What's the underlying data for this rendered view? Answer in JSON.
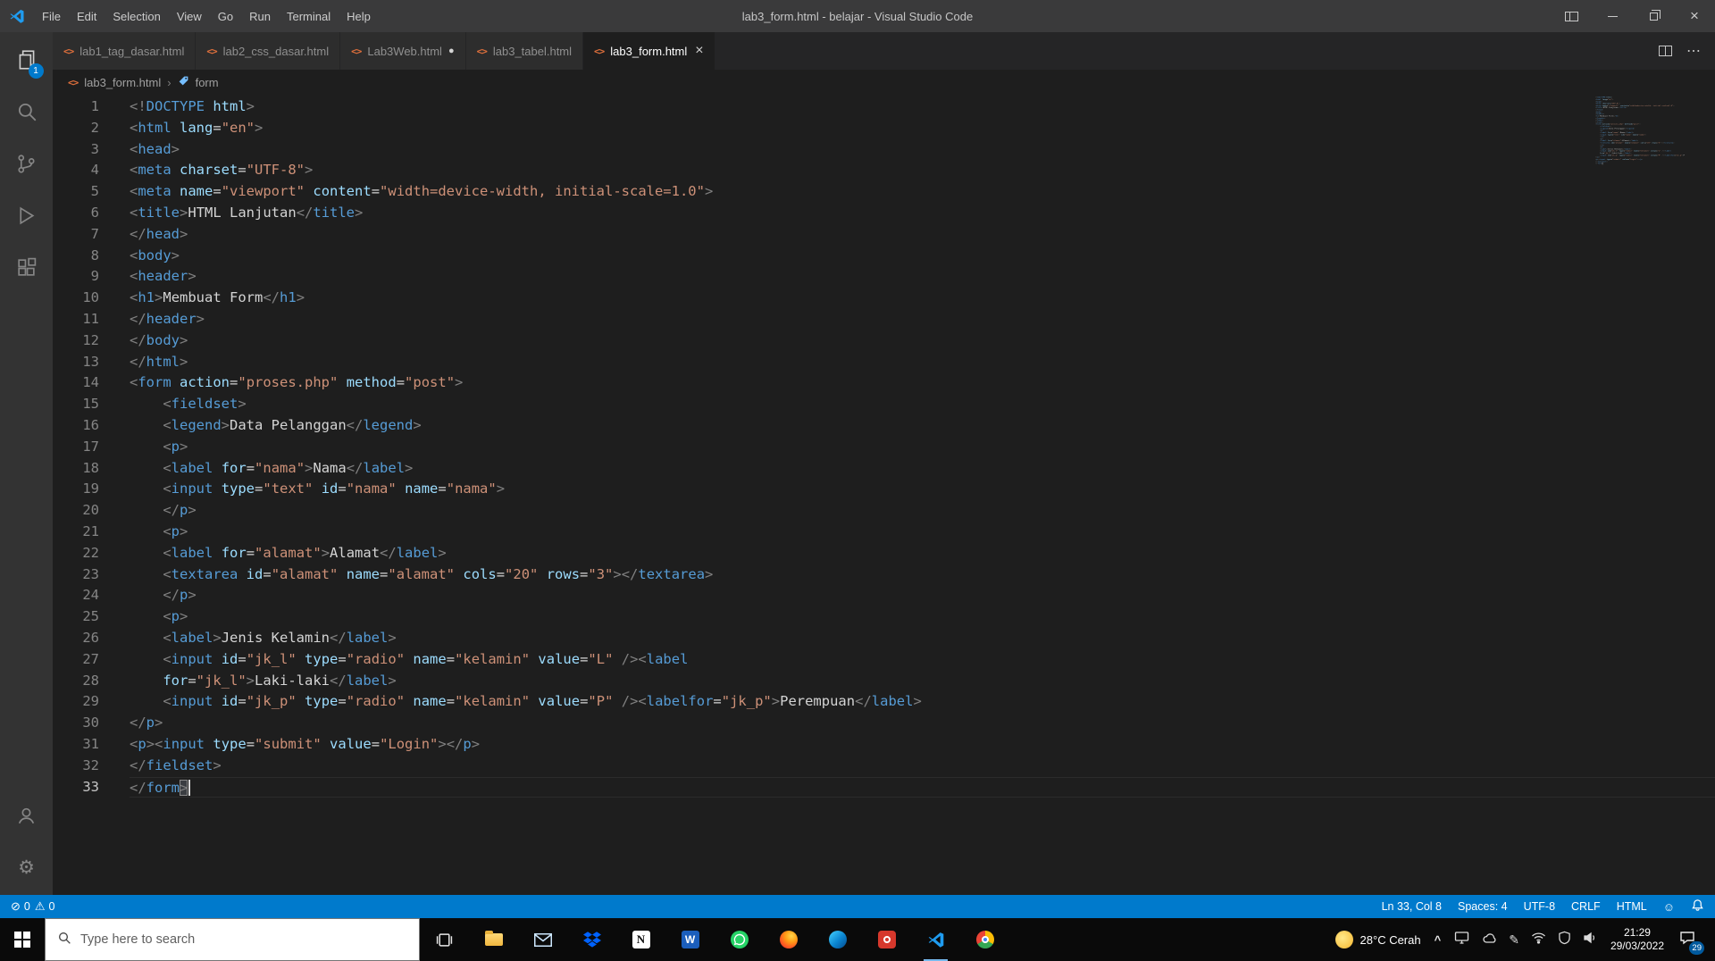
{
  "window": {
    "title": "lab3_form.html - belajar - Visual Studio Code"
  },
  "menu_bar": {
    "items": [
      "File",
      "Edit",
      "Selection",
      "View",
      "Go",
      "Run",
      "Terminal",
      "Help"
    ]
  },
  "tabs": [
    {
      "label": "lab1_tag_dasar.html",
      "modified": false,
      "active": false
    },
    {
      "label": "lab2_css_dasar.html",
      "modified": false,
      "active": false
    },
    {
      "label": "Lab3Web.html",
      "modified": true,
      "active": false
    },
    {
      "label": "lab3_tabel.html",
      "modified": false,
      "active": false
    },
    {
      "label": "lab3_form.html",
      "modified": false,
      "active": true
    }
  ],
  "breadcrumb": {
    "file": "lab3_form.html",
    "symbol": "form"
  },
  "activity_bar": {
    "explorer_badge": "1"
  },
  "editor": {
    "lines": [
      [
        [
          "p",
          "<!"
        ],
        [
          "t",
          "DOCTYPE"
        ],
        [
          "x",
          " "
        ],
        [
          "a",
          "html"
        ],
        [
          "p",
          ">"
        ]
      ],
      [
        [
          "p",
          "<"
        ],
        [
          "t",
          "html"
        ],
        [
          "x",
          " "
        ],
        [
          "a",
          "lang"
        ],
        [
          "x",
          "="
        ],
        [
          "v",
          "\"en\""
        ],
        [
          "p",
          ">"
        ]
      ],
      [
        [
          "p",
          "<"
        ],
        [
          "t",
          "head"
        ],
        [
          "p",
          ">"
        ]
      ],
      [
        [
          "p",
          "<"
        ],
        [
          "t",
          "meta"
        ],
        [
          "x",
          " "
        ],
        [
          "a",
          "charset"
        ],
        [
          "x",
          "="
        ],
        [
          "v",
          "\"UTF-8\""
        ],
        [
          "p",
          ">"
        ]
      ],
      [
        [
          "p",
          "<"
        ],
        [
          "t",
          "meta"
        ],
        [
          "x",
          " "
        ],
        [
          "a",
          "name"
        ],
        [
          "x",
          "="
        ],
        [
          "v",
          "\"viewport\""
        ],
        [
          "x",
          " "
        ],
        [
          "a",
          "content"
        ],
        [
          "x",
          "="
        ],
        [
          "v",
          "\"width=device-width, initial-scale=1.0\""
        ],
        [
          "p",
          ">"
        ]
      ],
      [
        [
          "p",
          "<"
        ],
        [
          "t",
          "title"
        ],
        [
          "p",
          ">"
        ],
        [
          "x",
          "HTML Lanjutan"
        ],
        [
          "p",
          "</"
        ],
        [
          "t",
          "title"
        ],
        [
          "p",
          ">"
        ]
      ],
      [
        [
          "p",
          "</"
        ],
        [
          "t",
          "head"
        ],
        [
          "p",
          ">"
        ]
      ],
      [
        [
          "p",
          "<"
        ],
        [
          "t",
          "body"
        ],
        [
          "p",
          ">"
        ]
      ],
      [
        [
          "p",
          "<"
        ],
        [
          "t",
          "header"
        ],
        [
          "p",
          ">"
        ]
      ],
      [
        [
          "p",
          "<"
        ],
        [
          "t",
          "h1"
        ],
        [
          "p",
          ">"
        ],
        [
          "x",
          "Membuat Form"
        ],
        [
          "p",
          "</"
        ],
        [
          "t",
          "h1"
        ],
        [
          "p",
          ">"
        ]
      ],
      [
        [
          "p",
          "</"
        ],
        [
          "t",
          "header"
        ],
        [
          "p",
          ">"
        ]
      ],
      [
        [
          "p",
          "</"
        ],
        [
          "t",
          "body"
        ],
        [
          "p",
          ">"
        ]
      ],
      [
        [
          "p",
          "</"
        ],
        [
          "t",
          "html"
        ],
        [
          "p",
          ">"
        ]
      ],
      [
        [
          "p",
          "<"
        ],
        [
          "t",
          "form"
        ],
        [
          "x",
          " "
        ],
        [
          "a",
          "action"
        ],
        [
          "x",
          "="
        ],
        [
          "v",
          "\"proses.php\""
        ],
        [
          "x",
          " "
        ],
        [
          "a",
          "method"
        ],
        [
          "x",
          "="
        ],
        [
          "v",
          "\"post\""
        ],
        [
          "p",
          ">"
        ]
      ],
      [
        [
          "x",
          "    "
        ],
        [
          "p",
          "<"
        ],
        [
          "t",
          "fieldset"
        ],
        [
          "p",
          ">"
        ]
      ],
      [
        [
          "x",
          "    "
        ],
        [
          "p",
          "<"
        ],
        [
          "t",
          "legend"
        ],
        [
          "p",
          ">"
        ],
        [
          "x",
          "Data Pelanggan"
        ],
        [
          "p",
          "</"
        ],
        [
          "t",
          "legend"
        ],
        [
          "p",
          ">"
        ]
      ],
      [
        [
          "x",
          "    "
        ],
        [
          "p",
          "<"
        ],
        [
          "t",
          "p"
        ],
        [
          "p",
          ">"
        ]
      ],
      [
        [
          "x",
          "    "
        ],
        [
          "p",
          "<"
        ],
        [
          "t",
          "label"
        ],
        [
          "x",
          " "
        ],
        [
          "a",
          "for"
        ],
        [
          "x",
          "="
        ],
        [
          "v",
          "\"nama\""
        ],
        [
          "p",
          ">"
        ],
        [
          "x",
          "Nama"
        ],
        [
          "p",
          "</"
        ],
        [
          "t",
          "label"
        ],
        [
          "p",
          ">"
        ]
      ],
      [
        [
          "x",
          "    "
        ],
        [
          "p",
          "<"
        ],
        [
          "t",
          "input"
        ],
        [
          "x",
          " "
        ],
        [
          "a",
          "type"
        ],
        [
          "x",
          "="
        ],
        [
          "v",
          "\"text\""
        ],
        [
          "x",
          " "
        ],
        [
          "a",
          "id"
        ],
        [
          "x",
          "="
        ],
        [
          "v",
          "\"nama\""
        ],
        [
          "x",
          " "
        ],
        [
          "a",
          "name"
        ],
        [
          "x",
          "="
        ],
        [
          "v",
          "\"nama\""
        ],
        [
          "p",
          ">"
        ]
      ],
      [
        [
          "x",
          "    "
        ],
        [
          "p",
          "</"
        ],
        [
          "t",
          "p"
        ],
        [
          "p",
          ">"
        ]
      ],
      [
        [
          "x",
          "    "
        ],
        [
          "p",
          "<"
        ],
        [
          "t",
          "p"
        ],
        [
          "p",
          ">"
        ]
      ],
      [
        [
          "x",
          "    "
        ],
        [
          "p",
          "<"
        ],
        [
          "t",
          "label"
        ],
        [
          "x",
          " "
        ],
        [
          "a",
          "for"
        ],
        [
          "x",
          "="
        ],
        [
          "v",
          "\"alamat\""
        ],
        [
          "p",
          ">"
        ],
        [
          "x",
          "Alamat"
        ],
        [
          "p",
          "</"
        ],
        [
          "t",
          "label"
        ],
        [
          "p",
          ">"
        ]
      ],
      [
        [
          "x",
          "    "
        ],
        [
          "p",
          "<"
        ],
        [
          "t",
          "textarea"
        ],
        [
          "x",
          " "
        ],
        [
          "a",
          "id"
        ],
        [
          "x",
          "="
        ],
        [
          "v",
          "\"alamat\""
        ],
        [
          "x",
          " "
        ],
        [
          "a",
          "name"
        ],
        [
          "x",
          "="
        ],
        [
          "v",
          "\"alamat\""
        ],
        [
          "x",
          " "
        ],
        [
          "a",
          "cols"
        ],
        [
          "x",
          "="
        ],
        [
          "v",
          "\"20\""
        ],
        [
          "x",
          " "
        ],
        [
          "a",
          "rows"
        ],
        [
          "x",
          "="
        ],
        [
          "v",
          "\"3\""
        ],
        [
          "p",
          "></"
        ],
        [
          "t",
          "textarea"
        ],
        [
          "p",
          ">"
        ]
      ],
      [
        [
          "x",
          "    "
        ],
        [
          "p",
          "</"
        ],
        [
          "t",
          "p"
        ],
        [
          "p",
          ">"
        ]
      ],
      [
        [
          "x",
          "    "
        ],
        [
          "p",
          "<"
        ],
        [
          "t",
          "p"
        ],
        [
          "p",
          ">"
        ]
      ],
      [
        [
          "x",
          "    "
        ],
        [
          "p",
          "<"
        ],
        [
          "t",
          "label"
        ],
        [
          "p",
          ">"
        ],
        [
          "x",
          "Jenis Kelamin"
        ],
        [
          "p",
          "</"
        ],
        [
          "t",
          "label"
        ],
        [
          "p",
          ">"
        ]
      ],
      [
        [
          "x",
          "    "
        ],
        [
          "p",
          "<"
        ],
        [
          "t",
          "input"
        ],
        [
          "x",
          " "
        ],
        [
          "a",
          "id"
        ],
        [
          "x",
          "="
        ],
        [
          "v",
          "\"jk_l\""
        ],
        [
          "x",
          " "
        ],
        [
          "a",
          "type"
        ],
        [
          "x",
          "="
        ],
        [
          "v",
          "\"radio\""
        ],
        [
          "x",
          " "
        ],
        [
          "a",
          "name"
        ],
        [
          "x",
          "="
        ],
        [
          "v",
          "\"kelamin\""
        ],
        [
          "x",
          " "
        ],
        [
          "a",
          "value"
        ],
        [
          "x",
          "="
        ],
        [
          "v",
          "\"L\""
        ],
        [
          "x",
          " "
        ],
        [
          "p",
          "/><"
        ],
        [
          "t",
          "label"
        ]
      ],
      [
        [
          "x",
          "    "
        ],
        [
          "a",
          "for"
        ],
        [
          "x",
          "="
        ],
        [
          "v",
          "\"jk_l\""
        ],
        [
          "p",
          ">"
        ],
        [
          "x",
          "Laki-laki"
        ],
        [
          "p",
          "</"
        ],
        [
          "t",
          "label"
        ],
        [
          "p",
          ">"
        ]
      ],
      [
        [
          "x",
          "    "
        ],
        [
          "p",
          "<"
        ],
        [
          "t",
          "input"
        ],
        [
          "x",
          " "
        ],
        [
          "a",
          "id"
        ],
        [
          "x",
          "="
        ],
        [
          "v",
          "\"jk_p\""
        ],
        [
          "x",
          " "
        ],
        [
          "a",
          "type"
        ],
        [
          "x",
          "="
        ],
        [
          "v",
          "\"radio\""
        ],
        [
          "x",
          " "
        ],
        [
          "a",
          "name"
        ],
        [
          "x",
          "="
        ],
        [
          "v",
          "\"kelamin\""
        ],
        [
          "x",
          " "
        ],
        [
          "a",
          "value"
        ],
        [
          "x",
          "="
        ],
        [
          "v",
          "\"P\""
        ],
        [
          "x",
          " "
        ],
        [
          "p",
          "/><"
        ],
        [
          "t",
          "labelfor"
        ],
        [
          "x",
          "="
        ],
        [
          "v",
          "\"jk_p\""
        ],
        [
          "p",
          ">"
        ],
        [
          "x",
          "Perempuan"
        ],
        [
          "p",
          "</"
        ],
        [
          "t",
          "label"
        ],
        [
          "p",
          ">"
        ]
      ],
      [
        [
          "p",
          "</"
        ],
        [
          "t",
          "p"
        ],
        [
          "p",
          ">"
        ]
      ],
      [
        [
          "p",
          "<"
        ],
        [
          "t",
          "p"
        ],
        [
          "p",
          "><"
        ],
        [
          "t",
          "input"
        ],
        [
          "x",
          " "
        ],
        [
          "a",
          "type"
        ],
        [
          "x",
          "="
        ],
        [
          "v",
          "\"submit\""
        ],
        [
          "x",
          " "
        ],
        [
          "a",
          "value"
        ],
        [
          "x",
          "="
        ],
        [
          "v",
          "\"Login\""
        ],
        [
          "p",
          "></"
        ],
        [
          "t",
          "p"
        ],
        [
          "p",
          ">"
        ]
      ],
      [
        [
          "p",
          "</"
        ],
        [
          "t",
          "fieldset"
        ],
        [
          "p",
          ">"
        ]
      ],
      [
        [
          "p",
          "</"
        ],
        [
          "t",
          "form"
        ],
        [
          "b",
          ">"
        ]
      ]
    ]
  },
  "status_bar": {
    "errors": "0",
    "warnings": "0",
    "cursor_position": "Ln 33, Col 8",
    "indentation": "Spaces: 4",
    "encoding": "UTF-8",
    "line_ending": "CRLF",
    "language": "HTML"
  },
  "taskbar": {
    "search_placeholder": "Type here to search",
    "weather": "28°C Cerah",
    "time": "21:29",
    "date": "29/03/2022",
    "notification_count": "29",
    "apps": [
      "task-view",
      "file-explorer",
      "mail",
      "dropbox",
      "notion",
      "word",
      "whatsapp",
      "firefox",
      "edge",
      "red-app",
      "vscode",
      "chrome"
    ],
    "tray_icons": [
      "display",
      "cloud",
      "pen",
      "network",
      "shield",
      "volume"
    ]
  },
  "icons": {
    "html_file": "<>",
    "modified_dot": "●",
    "close": "×",
    "breadcrumb_separator": "›",
    "ellipsis": "⋯",
    "error": "⊘",
    "warning": "⚠",
    "feedback": "☺",
    "gear": "⚙",
    "tray_chevron": "^",
    "notion": "N",
    "word": "W"
  }
}
